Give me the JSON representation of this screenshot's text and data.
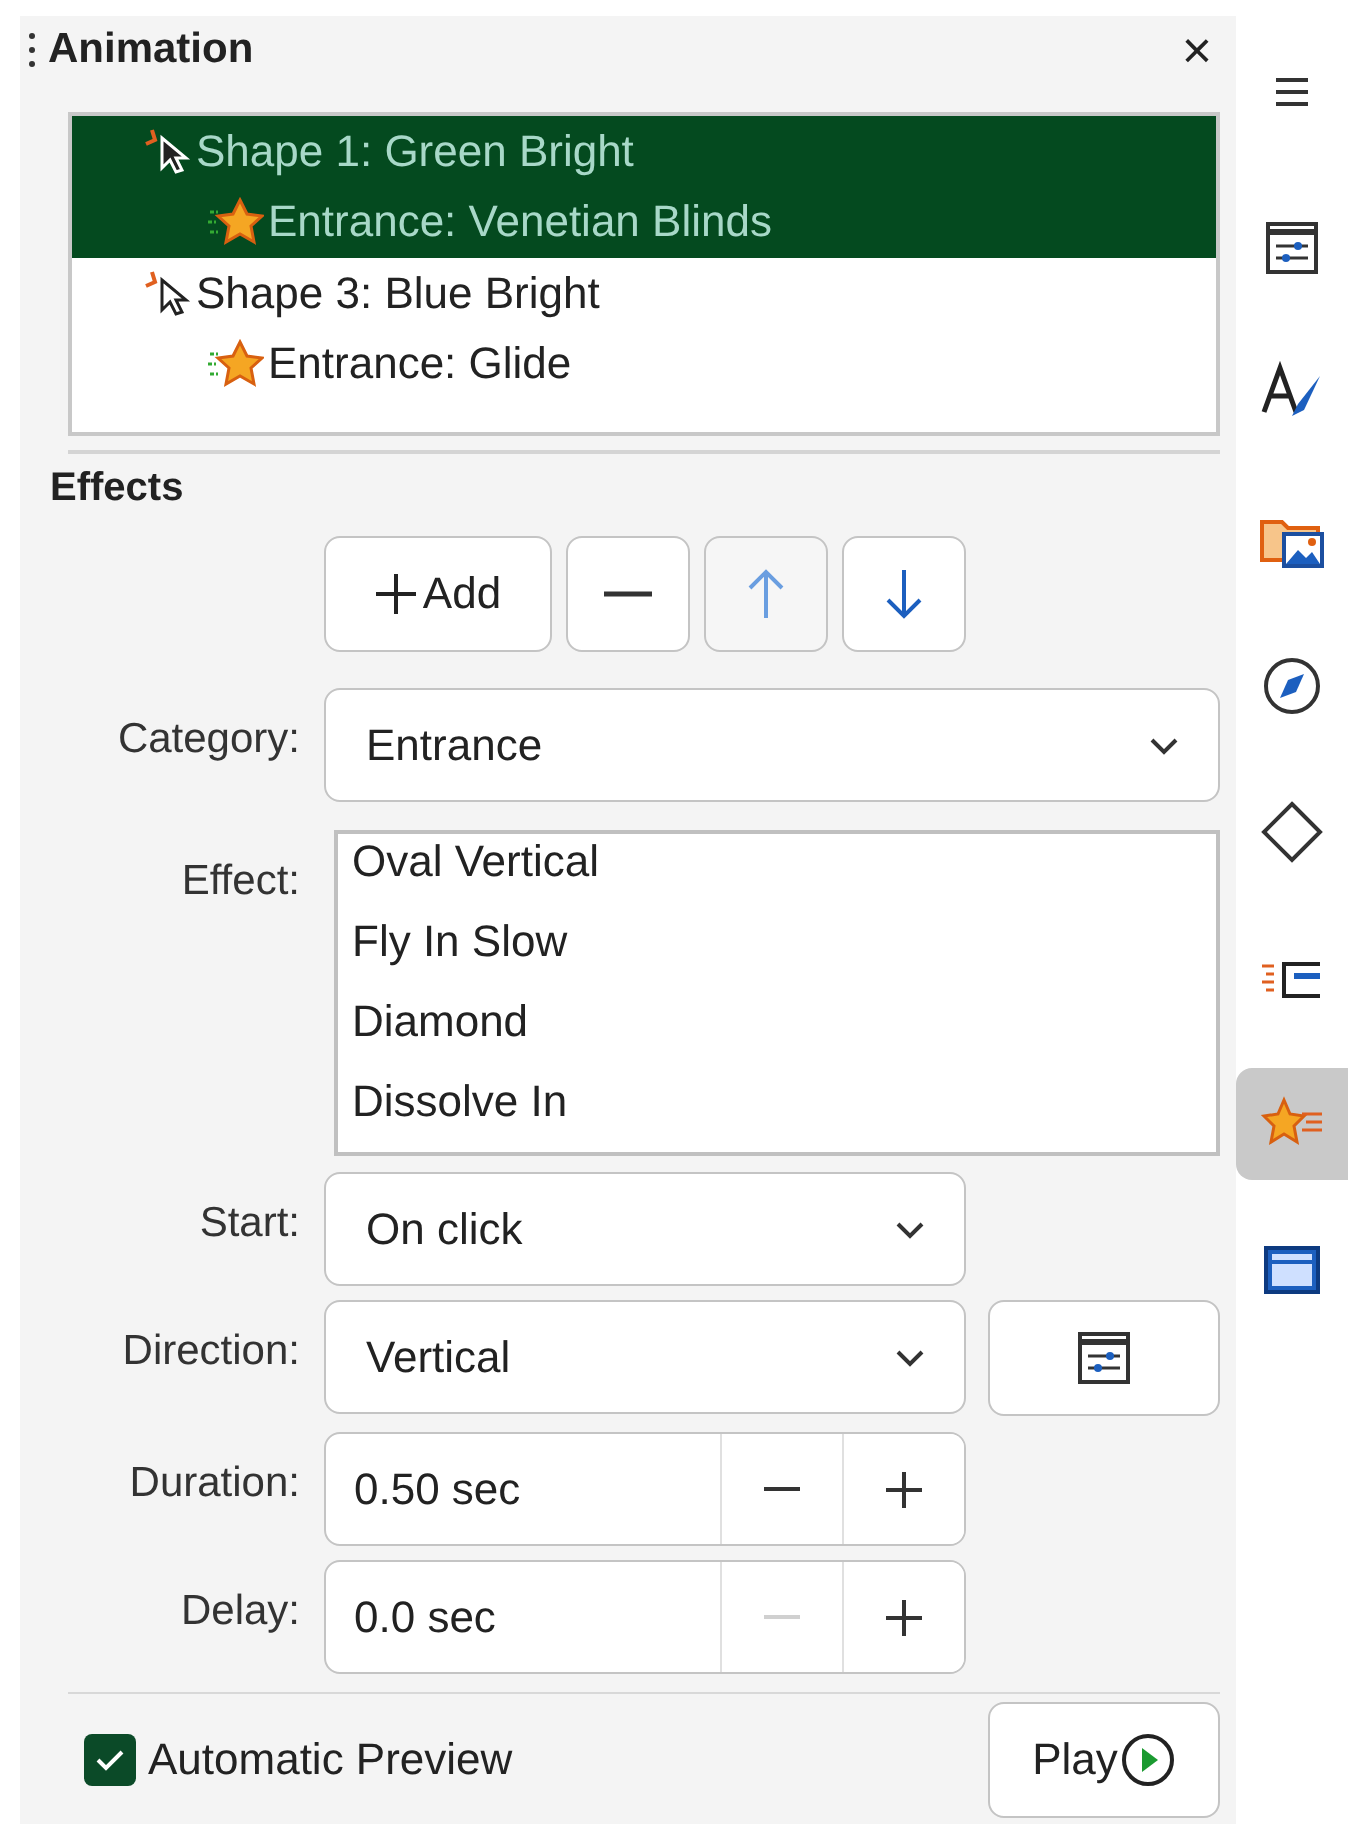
{
  "panel": {
    "title": "Animation",
    "close": "×"
  },
  "tree": [
    {
      "label": "Shape 1: Green Bright",
      "selected": true,
      "children": [
        {
          "label": "Entrance: Venetian Blinds",
          "selected": true
        }
      ]
    },
    {
      "label": "Shape 3: Blue Bright",
      "selected": false,
      "children": [
        {
          "label": "Entrance: Glide",
          "selected": false
        }
      ]
    }
  ],
  "effects": {
    "heading": "Effects",
    "buttons": [
      {
        "kind": "add",
        "label": "Add",
        "disabled": false
      },
      {
        "kind": "remove",
        "disabled": false
      },
      {
        "kind": "up",
        "disabled": true
      },
      {
        "kind": "down",
        "disabled": false
      }
    ],
    "category": {
      "label": "Category:",
      "value": "Entrance"
    },
    "effect": {
      "label": "Effect:",
      "items": [
        "Oval Vertical",
        "Fly In Slow",
        "Diamond",
        "Dissolve In"
      ]
    },
    "start": {
      "label": "Start:",
      "value": "On click"
    },
    "direction": {
      "label": "Direction:",
      "value": "Vertical"
    },
    "duration": {
      "label": "Duration:",
      "value": "0.50 sec",
      "minus_disabled": false
    },
    "delay": {
      "label": "Delay:",
      "value": "0.0 sec",
      "minus_disabled": true
    }
  },
  "automatic_preview": {
    "label": "Automatic Preview",
    "checked": true
  },
  "play": {
    "label": "Play"
  },
  "sidebar": [
    {
      "kind": "menu",
      "selected": false
    },
    {
      "kind": "properties",
      "selected": false
    },
    {
      "kind": "styles",
      "selected": false
    },
    {
      "kind": "gallery",
      "selected": false
    },
    {
      "kind": "navigator",
      "selected": false
    },
    {
      "kind": "shapes",
      "selected": false
    },
    {
      "kind": "transition",
      "selected": false
    },
    {
      "kind": "animation",
      "selected": true
    },
    {
      "kind": "master",
      "selected": false
    }
  ]
}
